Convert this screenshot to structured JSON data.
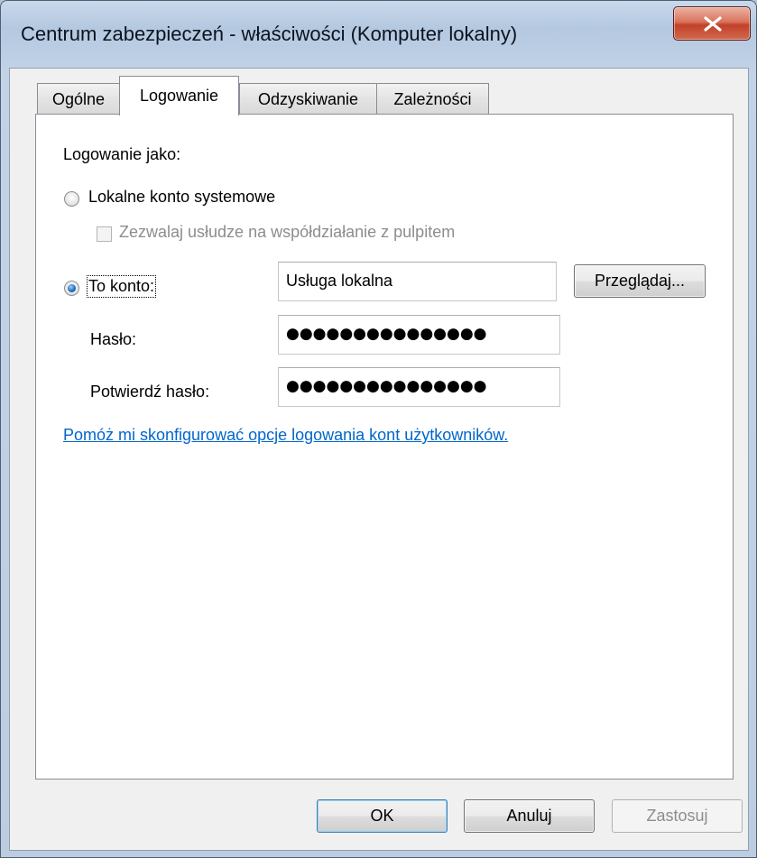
{
  "window": {
    "title": "Centrum zabezpieczeń - właściwości (Komputer lokalny)"
  },
  "tabs": [
    {
      "label": "Ogólne",
      "active": false
    },
    {
      "label": "Logowanie",
      "active": true
    },
    {
      "label": "Odzyskiwanie",
      "active": false
    },
    {
      "label": "Zależności",
      "active": false
    }
  ],
  "logon": {
    "heading": "Logowanie jako:",
    "local_system_label": "Lokalne konto systemowe",
    "local_system_selected": false,
    "desktop_interact_label": "Zezwalaj usłudze na współdziałanie z pulpitem",
    "desktop_interact_checked": false,
    "this_account_label": "To konto:",
    "this_account_selected": true,
    "account_value": "Usługa lokalna",
    "browse_label": "Przeglądaj...",
    "password_label": "Hasło:",
    "password_value": "●●●●●●●●●●●●●●●",
    "confirm_label": "Potwierdź hasło:",
    "confirm_value": "●●●●●●●●●●●●●●●",
    "help_link": "Pomóż mi skonfigurować opcje logowania kont użytkowników."
  },
  "buttons": {
    "ok": "OK",
    "cancel": "Anuluj",
    "apply": "Zastosuj"
  }
}
